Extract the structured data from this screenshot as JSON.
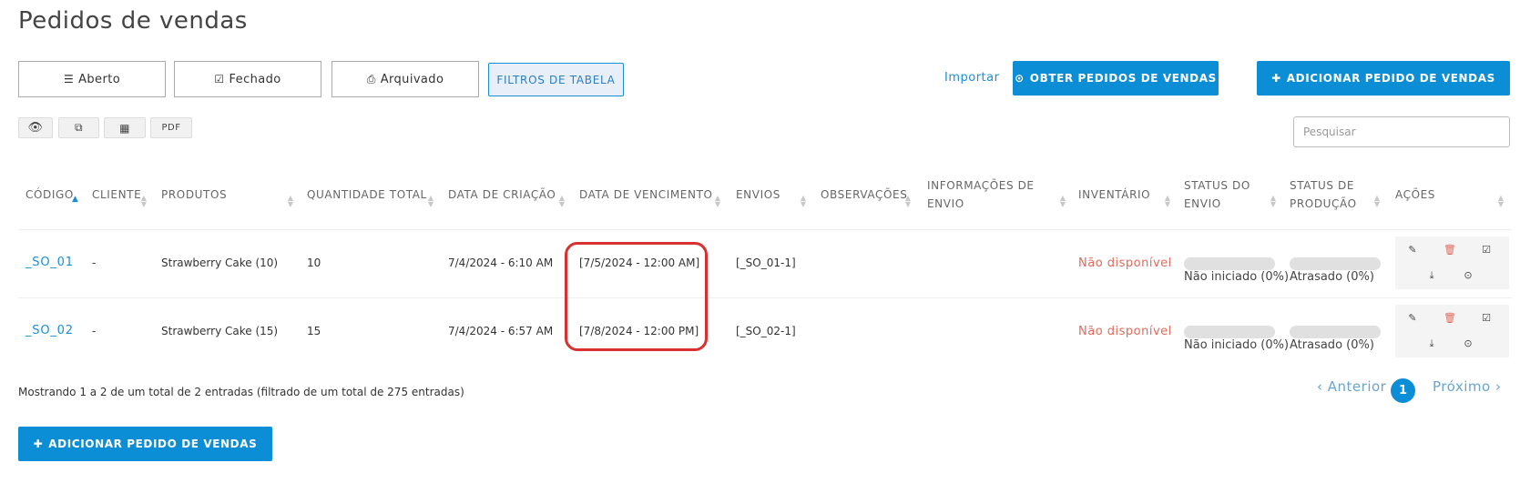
{
  "page_title": "Pedidos de vendas",
  "tabs": [
    {
      "label": "Aberto",
      "icon": "list-icon"
    },
    {
      "label": "Fechado",
      "icon": "check-square-icon"
    },
    {
      "label": "Arquivado",
      "icon": "inbox-icon"
    }
  ],
  "filter_label": "FILTROS DE TABELA",
  "import_label": "Importar",
  "get_orders_label": "OBTER PEDIDOS DE VENDAS",
  "add_order_label": "ADICIONAR PEDIDO DE VENDAS",
  "toolbar": {
    "pdf_label": "PDF"
  },
  "search": {
    "placeholder": "Pesquisar",
    "value": ""
  },
  "table": {
    "headers": {
      "code": "CÓDIGO",
      "client": "CLIENTE",
      "products": "PRODUTOS",
      "total_qty": "QUANTIDADE TOTAL",
      "created": "DATA DE CRIAÇÃO",
      "due": "DATA DE VENCIMENTO",
      "shipments": "ENVIOS",
      "notes": "OBSERVAÇÕES",
      "ship_info_1": "INFORMAÇÕES DE",
      "ship_info_2": "ENVIO",
      "inventory": "INVENTÁRIO",
      "ship_status_1": "STATUS DO",
      "ship_status_2": "ENVIO",
      "prod_status_1": "STATUS DE",
      "prod_status_2": "PRODUÇÃO",
      "actions": "AÇÕES"
    },
    "rows": [
      {
        "code": "_SO_01",
        "client": "-",
        "products": "Strawberry Cake (10)",
        "total_qty": "10",
        "created": "7/4/2024 - 6:10 AM",
        "due": "[7/5/2024 - 12:00 AM]",
        "shipments": "[_SO_01-1]",
        "inventory": "Não disponível",
        "ship_status": "Não iniciado (0%)",
        "ship_progress": 0,
        "prod_status": "Atrasado (0%)",
        "prod_progress": 0
      },
      {
        "code": "_SO_02",
        "client": "-",
        "products": "Strawberry Cake (15)",
        "total_qty": "15",
        "created": "7/4/2024 - 6:57 AM",
        "due": "[7/8/2024 - 12:00 PM]",
        "shipments": "[_SO_02-1]",
        "inventory": "Não disponível",
        "ship_status": "Não iniciado (0%)",
        "ship_progress": 0,
        "prod_status": "Atrasado (0%)",
        "prod_progress": 0
      }
    ]
  },
  "footer": {
    "info": "Mostrando 1 a 2 de um total de 2 entradas (filtrado de um total de 275 entradas)",
    "prev_label": "Anterior",
    "page": "1",
    "next_label": "Próximo"
  },
  "colors": {
    "accent": "#0c8ed6",
    "danger": "#e06a5c",
    "highlight": "#d93030"
  }
}
